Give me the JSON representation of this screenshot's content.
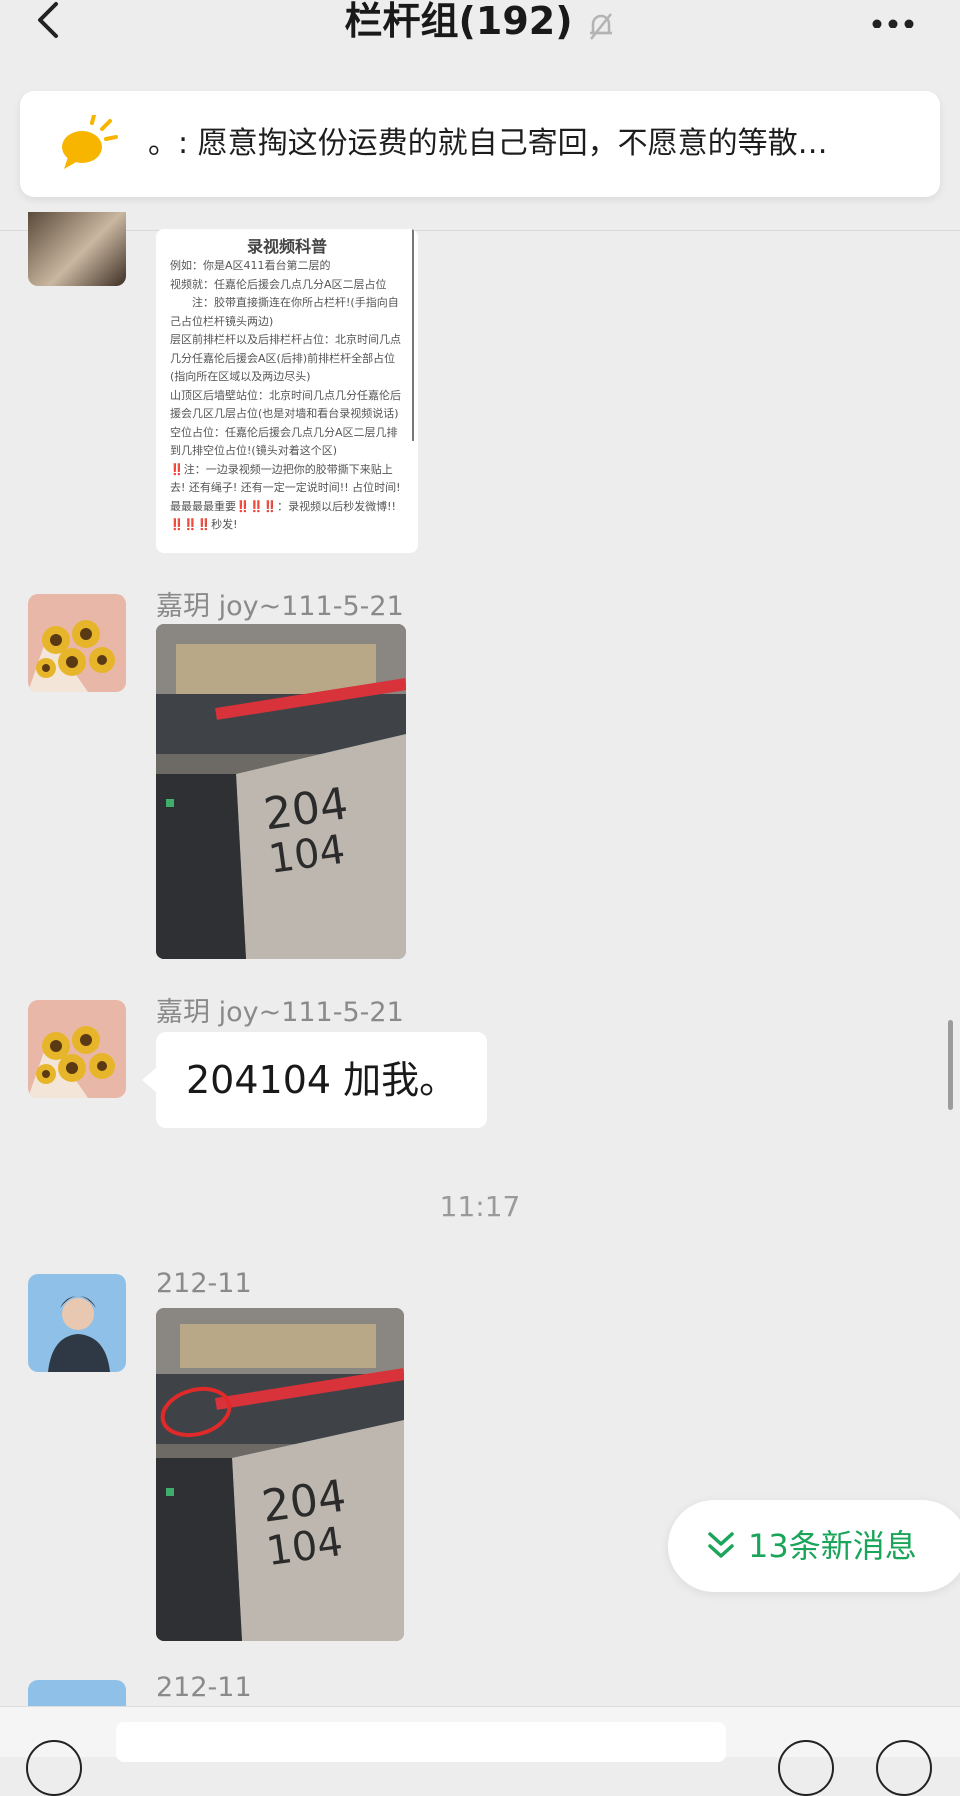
{
  "header": {
    "back_icon": "chevron-left-icon",
    "title": "栏杆组(192)",
    "mute_icon": "muted-bell-icon",
    "more_icon": "more-dots-icon"
  },
  "pinned_notice": {
    "icon": "announcement-speech-icon",
    "icon_color": "#f7b500",
    "text": "。: 愿意掏这份运费的就自己寄回，不愿意的等散…"
  },
  "doc_image": {
    "title": "录视频科普",
    "lines": [
      "例如：你是A区411看台第二层的",
      "视频就：任嘉伦后援会几点几分A区二层占位",
      "　　注：胶带直接撕连在你所占栏杆!(手指向自己占位栏杆镜头两边)",
      "层区前排栏杆以及后排栏杆占位：北京时间几点几分任嘉伦后援会A区(后排)前排栏杆全部占位(指向所在区域以及两边尽头)",
      "山顶区后墙壁站位：北京时间几点几分任嘉伦后援会几区几层占位(也是对墙和看台录视频说话)",
      "空位占位：任嘉伦后援会几点几分A区二层几排到几排空位占位!(镜头对着这个区)",
      "‼️注：一边录视频一边把你的胶带撕下来贴上去! 还有绳子! 还有一定一定说时间!! 占位时间!",
      "最最最最重要‼️‼️‼️：录视频以后秒发微博!! ‼️‼️‼️秒发!"
    ]
  },
  "messages": [
    {
      "sender": "嘉玥 joy~111-5-21",
      "type": "image",
      "photo_text": [
        "204",
        "104"
      ]
    },
    {
      "sender": "嘉玥 joy~111-5-21",
      "type": "text",
      "text": "204104 加我。"
    },
    {
      "sender": "212-11",
      "type": "image",
      "photo_text": [
        "204",
        "104"
      ]
    },
    {
      "sender": "212-11",
      "type": "partial"
    }
  ],
  "timestamp": "11:17",
  "new_messages": {
    "icon": "double-chevron-down-icon",
    "label": "13条新消息",
    "color": "#1aa55a"
  },
  "input_bar": {
    "voice_icon": "voice-icon",
    "emoji_icon": "emoji-icon",
    "plus_icon": "plus-icon"
  }
}
